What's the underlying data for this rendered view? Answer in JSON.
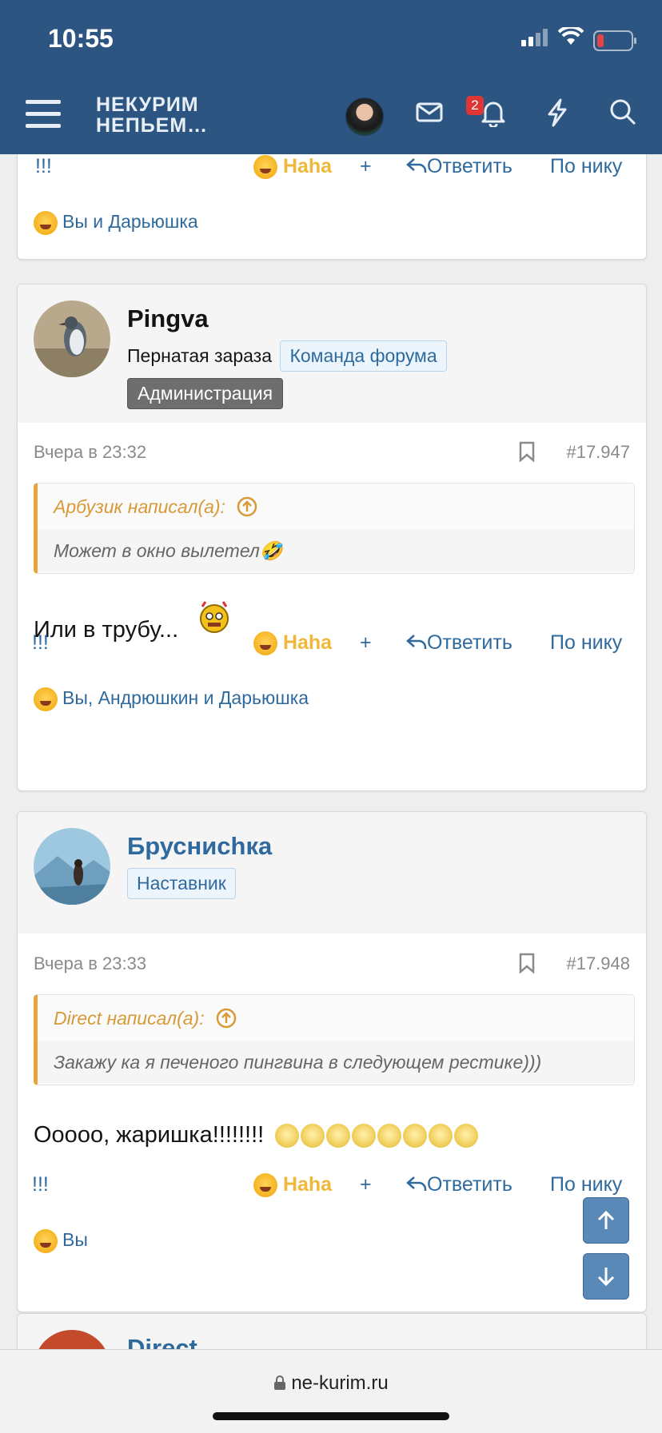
{
  "status": {
    "time": "10:55"
  },
  "header": {
    "logo_line1": "НЕКУРИМ",
    "logo_line2": "НЕПЬЕМ…",
    "notifications_count": "2"
  },
  "colors": {
    "header_bg": "#2d5582",
    "link": "#2f6a9e",
    "haha": "#f0b83a",
    "quote_accent": "#e8a33d"
  },
  "top_partial": {
    "actions": {
      "exclaim": "!!!",
      "haha": "Haha",
      "plus": "+",
      "reply": "Ответить",
      "by_nick": "По нику"
    },
    "reactions": "Вы и Дарьюшка"
  },
  "posts": [
    {
      "username": "Pingva",
      "user_title": "Пернатая зараза",
      "tags": [
        "Команда форума",
        "Администрация"
      ],
      "date": "Вчера в 23:32",
      "number": "#17.947",
      "quote_author": "Арбузик написал(а):",
      "quote_text": "Может в окно вылетел🤣",
      "message": "Или в трубу...",
      "actions": {
        "exclaim": "!!!",
        "haha": "Haha",
        "plus": "+",
        "reply": "Ответить",
        "by_nick": "По нику"
      },
      "reactions": "Вы, Андрюшкин и Дарьюшка"
    },
    {
      "username": "Бруснисhка",
      "tags": [
        "Наставник"
      ],
      "date": "Вчера в 23:33",
      "number": "#17.948",
      "quote_author": "Direct написал(а):",
      "quote_text": "Закажу ка я печеного пингвина в следующем рестике)))",
      "message": "Ооооо, жаришка!!!!!!!!",
      "actions": {
        "exclaim": "!!!",
        "haha": "Haha",
        "plus": "+",
        "reply": "Ответить",
        "by_nick": "По нику"
      },
      "reactions": "Вы"
    },
    {
      "username": "Direct"
    }
  ],
  "browser": {
    "url": "ne-kurim.ru"
  },
  "icons": [
    "menu-icon",
    "mail-icon",
    "bell-icon",
    "lightning-icon",
    "search-icon",
    "bookmark-icon",
    "reply-icon",
    "lock-icon",
    "arrow-up-icon",
    "arrow-down-icon"
  ]
}
